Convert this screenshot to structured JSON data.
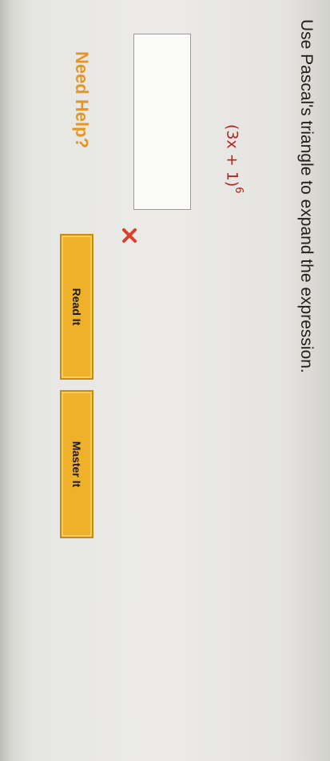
{
  "question": {
    "instruction": "Use Pascal's triangle to expand the expression.",
    "expression_base": "(3x + 1)",
    "expression_exponent": "6"
  },
  "answer": {
    "value": "",
    "status_icon": "x-mark-icon",
    "status_color": "#d9412b"
  },
  "help": {
    "label": "Need Help?",
    "read_it": "Read It",
    "master_it": "Master It"
  },
  "colors": {
    "help_text": "#e8951e",
    "button_fill": "#f0b12a",
    "expression": "#b3261e"
  }
}
